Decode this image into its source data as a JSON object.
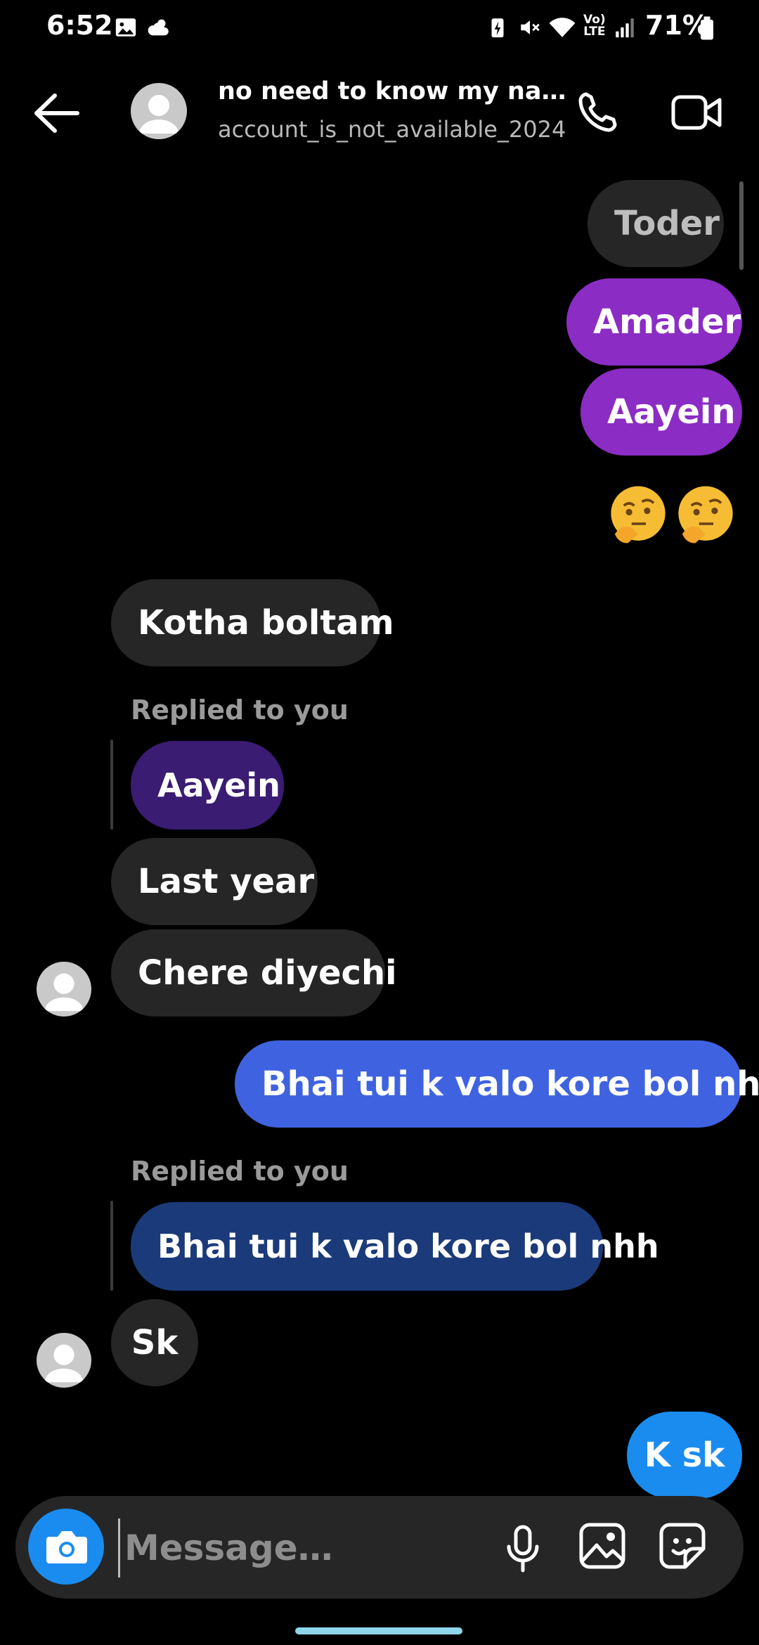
{
  "status_bar": {
    "time": "6:52",
    "battery": "71%",
    "icons": [
      "gallery-icon",
      "weather-icon",
      "battery-saver-icon",
      "mute-icon",
      "wifi-icon",
      "volte-icon",
      "signal-icon",
      "battery-icon"
    ]
  },
  "header": {
    "name": "no need to know my na…",
    "username": "account_is_not_available_2024"
  },
  "messages": {
    "m1": "Toder",
    "m2": "Amader",
    "m3": "Aayein",
    "emoji": "🤔🤔",
    "t1": "Kotha boltam",
    "reply1_label": "Replied to you",
    "reply1_quote": "Aayein",
    "t2": "Last year",
    "t3": "Chere diyechi",
    "m4": "Bhai tui k valo kore bol nhh",
    "reply2_label": "Replied to you",
    "reply2_quote": "Bhai tui k valo kore bol nhh",
    "t4": "Sk",
    "m5": "K sk"
  },
  "composer": {
    "placeholder": "Message…"
  },
  "colors": {
    "accent": "#1a8cf0",
    "sent_purple": "#8b2cc4",
    "sent_blue": "#3f63e0",
    "received": "#262626"
  }
}
